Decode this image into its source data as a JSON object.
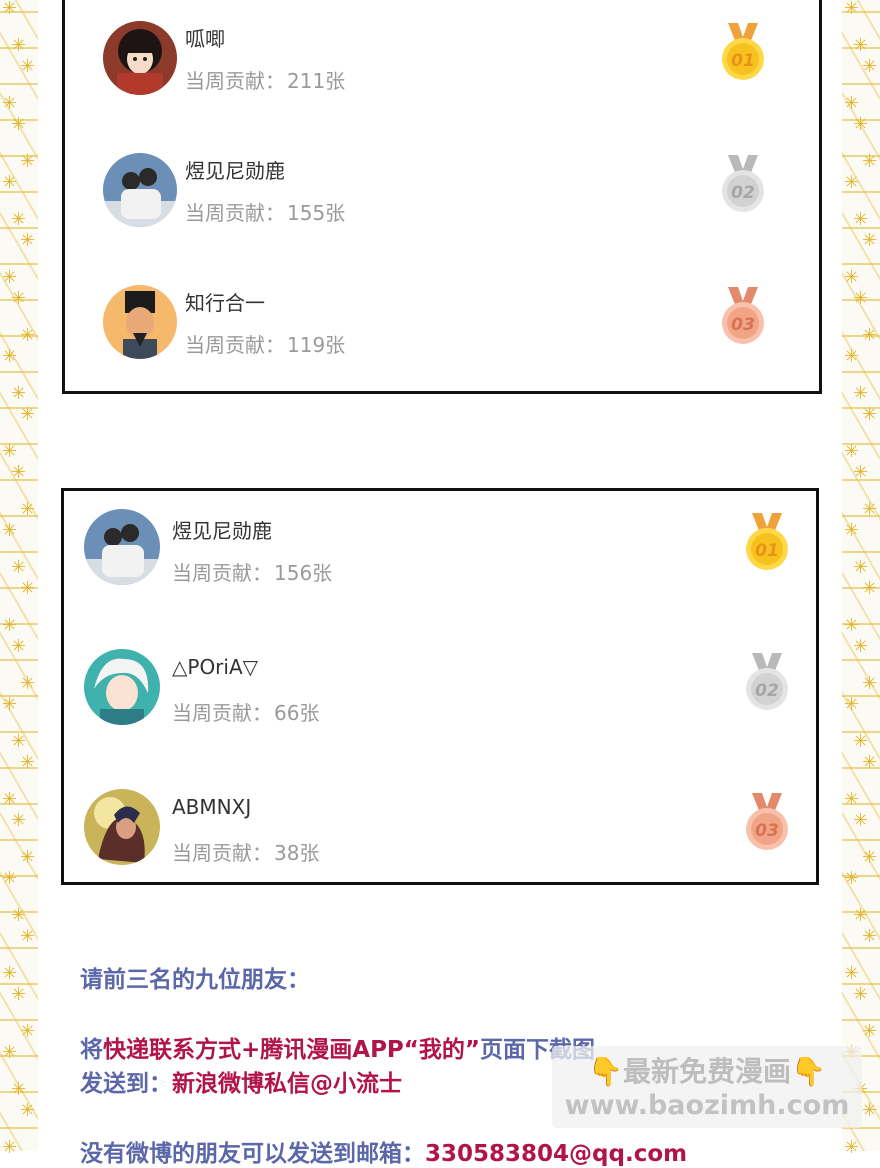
{
  "leaderboard_1": {
    "entries": [
      {
        "rank": "01",
        "name": "呱唧",
        "label": "当周贡献：",
        "count": "211张",
        "medal": "gold"
      },
      {
        "rank": "02",
        "name": "煜见尼勋鹿",
        "label": "当周贡献：",
        "count": "155张",
        "medal": "silver"
      },
      {
        "rank": "03",
        "name": "知行合一",
        "label": "当周贡献：",
        "count": "119张",
        "medal": "bronze"
      }
    ]
  },
  "leaderboard_2": {
    "entries": [
      {
        "rank": "01",
        "name": "煜见尼勋鹿",
        "label": "当周贡献：",
        "count": "156张",
        "medal": "gold"
      },
      {
        "rank": "02",
        "name": "△POriA▽",
        "label": "当周贡献：",
        "count": "66张",
        "medal": "silver"
      },
      {
        "rank": "03",
        "name": "ABMNXJ",
        "label": "当周贡献：",
        "count": "38张",
        "medal": "bronze"
      }
    ]
  },
  "notice": {
    "line1": "请前三名的九位朋友：",
    "line2_a": "将",
    "line2_b": "快递联系方式+腾讯漫画APP“我的”",
    "line2_c": "页面下截图",
    "line3_a": "发送到：",
    "line3_b": "新浪微博私信@小流士",
    "line4_a": "没有微博的朋友可以发送到邮箱：",
    "line4_b": "330583804@qq.com"
  },
  "watermark": {
    "line1": "最新免费漫画",
    "line2": "www.baozimh.com"
  },
  "colors": {
    "gold": "#f5c21b",
    "silver": "#cfcfcf",
    "bronze": "#f0a48a",
    "blue_text": "#5b67a8",
    "red_text": "#b0144a"
  }
}
